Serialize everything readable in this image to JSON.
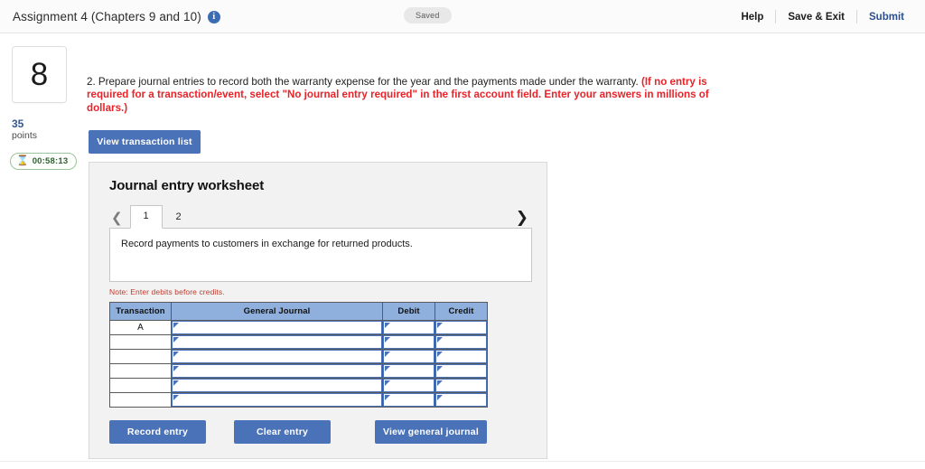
{
  "header": {
    "assignment_title": "Assignment 4 (Chapters 9 and 10)",
    "info_icon": "info-icon",
    "saved_badge": "Saved",
    "help_label": "Help",
    "save_exit_label": "Save & Exit",
    "submit_label": "Submit",
    "submit_color": "#2b4f8e"
  },
  "rail": {
    "question_number": "8",
    "points_value": "35",
    "points_label": "points",
    "timer_icon": "hourglass-icon",
    "timer_value": "00:58:13",
    "timer_color": "#4f8a4f"
  },
  "question": {
    "prompt": "2. Prepare journal entries to record both the warranty expense for the year and the payments made under the warranty. ",
    "instruction_red": "(If no entry is required for a transaction/event, select \"No journal entry required\" in the first account field. Enter your answers in millions of dollars.)",
    "red_color": "#e8232a",
    "view_transaction_list_label": "View transaction list"
  },
  "worksheet": {
    "title": "Journal entry worksheet",
    "prev_icon": "chevron-left-icon",
    "next_icon": "chevron-right-icon",
    "tabs": [
      {
        "label": "1",
        "active": true
      },
      {
        "label": "2",
        "active": false
      }
    ],
    "description": "Record payments to customers in exchange for returned products.",
    "note": "Note: Enter debits before credits.",
    "note_color": "#c0392b",
    "accent_color": "#4a72b8",
    "header_fill": "#8fb0dd",
    "table": {
      "columns": [
        "Transaction",
        "General Journal",
        "Debit",
        "Credit"
      ],
      "rows": [
        {
          "transaction": "A",
          "general_journal": "",
          "debit": "",
          "credit": ""
        },
        {
          "transaction": "",
          "general_journal": "",
          "debit": "",
          "credit": ""
        },
        {
          "transaction": "",
          "general_journal": "",
          "debit": "",
          "credit": ""
        },
        {
          "transaction": "",
          "general_journal": "",
          "debit": "",
          "credit": ""
        },
        {
          "transaction": "",
          "general_journal": "",
          "debit": "",
          "credit": ""
        },
        {
          "transaction": "",
          "general_journal": "",
          "debit": "",
          "credit": ""
        }
      ]
    },
    "actions": {
      "record_entry_label": "Record entry",
      "clear_entry_label": "Clear entry",
      "view_general_journal_label": "View general journal"
    }
  }
}
